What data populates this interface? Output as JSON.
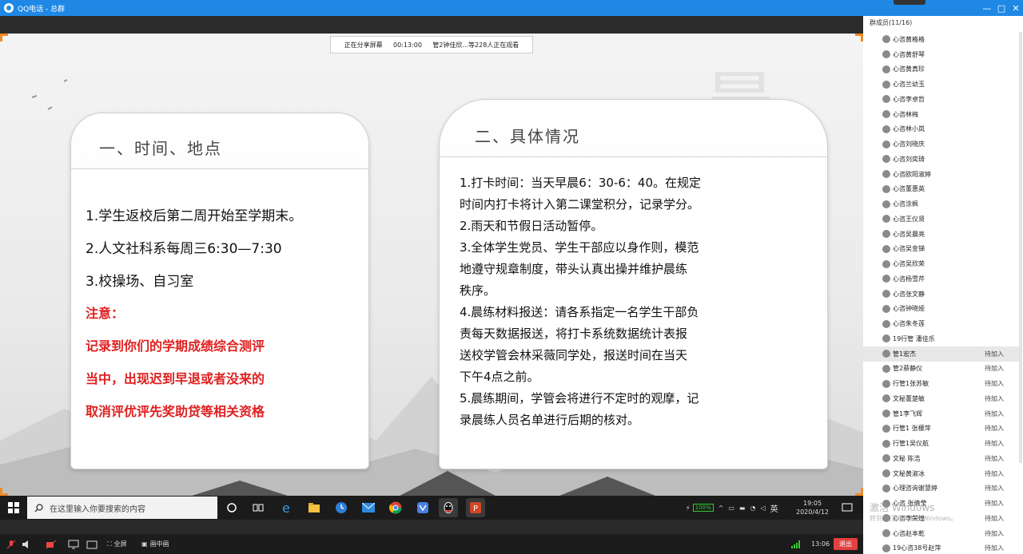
{
  "window": {
    "title": "QQ电话 - 总群",
    "controls": [
      "—",
      "□",
      "✕"
    ]
  },
  "share_bar": {
    "status": "正在分享屏幕",
    "duration": "00:13:00",
    "viewers": "管2钟佳欣...等228人正在观看"
  },
  "slide": {
    "left_card": {
      "title": "一、时间、地点",
      "lines": [
        "1.学生返校后第二周开始至学期末。",
        "2.人文社科系每周三6:30—7:30",
        "3.校操场、自习室"
      ],
      "note_label": "注意：",
      "note_lines": [
        "记录到你们的学期成绩综合测评",
        "当中，出现迟到早退或者没来的",
        "取消评优评先奖助贷等相关资格"
      ]
    },
    "right_card": {
      "title": "二、具体情况",
      "lines": [
        "1.打卡时间：当天早晨6：30-6：40。在规定",
        "时间内打卡将计入第二课堂积分，记录学分。",
        "2.雨天和节假日活动暂停。",
        "3.全体学生党员、学生干部应以身作则，模范",
        "地遵守规章制度，带头认真出操并维护晨练",
        "秩序。",
        "4.晨练材料报送：请各系指定一名学生干部负",
        "责每天数据报送，将打卡系统数据统计表报",
        "送校学管会林采薇同学处，报送时间在当天",
        "下午4点之前。",
        "5.晨练期间，学管会将进行不定时的观摩，记",
        "录晨练人员名单进行后期的核对。"
      ]
    }
  },
  "taskbar": {
    "search_placeholder": "在这里输入你要搜索的内容",
    "battery": "100%",
    "ime": "英",
    "time": "19:05",
    "date": "2020/4/12"
  },
  "meeting_bar": {
    "fullscreen": "全屏",
    "pip": "画中画",
    "clock": "13:06",
    "exit": "退出"
  },
  "members": {
    "header": "群成员(11/16)",
    "items": [
      {
        "name": "心咨黄格格",
        "status": ""
      },
      {
        "name": "心咨黄舒琴",
        "status": ""
      },
      {
        "name": "心咨黄真珍",
        "status": ""
      },
      {
        "name": "心咨兰幼玉",
        "status": ""
      },
      {
        "name": "心咨李卓哲",
        "status": ""
      },
      {
        "name": "心咨林梅",
        "status": ""
      },
      {
        "name": "心咨林小岚",
        "status": ""
      },
      {
        "name": "心咨刘晓庆",
        "status": ""
      },
      {
        "name": "心咨刘奕琦",
        "status": ""
      },
      {
        "name": "心咨欧阳淑婷",
        "status": ""
      },
      {
        "name": "心咨董惠英",
        "status": ""
      },
      {
        "name": "心咨涂枫",
        "status": ""
      },
      {
        "name": "心咨王仪贤",
        "status": ""
      },
      {
        "name": "心咨吴晨亮",
        "status": ""
      },
      {
        "name": "心咨吴金锑",
        "status": ""
      },
      {
        "name": "心咨吴欣荣",
        "status": ""
      },
      {
        "name": "心咨杨雪芹",
        "status": ""
      },
      {
        "name": "心咨张文静",
        "status": ""
      },
      {
        "name": "心咨钟晓娅",
        "status": ""
      },
      {
        "name": "心咨朱冬莲",
        "status": ""
      },
      {
        "name": "19行管 潘佳乐",
        "status": ""
      },
      {
        "name": "管1宏杰",
        "status": "待加入"
      },
      {
        "name": "管2蔡静仪",
        "status": "待加入"
      },
      {
        "name": "行管1张苏敏",
        "status": "待加入"
      },
      {
        "name": "文秘董楚敏",
        "status": "待加入"
      },
      {
        "name": "管1李飞辉",
        "status": "待加入"
      },
      {
        "name": "行管1 张檬萍",
        "status": "待加入"
      },
      {
        "name": "行管1吴仪航",
        "status": "待加入"
      },
      {
        "name": "文秘 陈浩",
        "status": "待加入"
      },
      {
        "name": "文秘黄淑冰",
        "status": "待加入"
      },
      {
        "name": "心理咨询谢慧婷",
        "status": "待加入"
      },
      {
        "name": "心咨 张倩莹",
        "status": "待加入"
      },
      {
        "name": "心咨李荣煌",
        "status": "待加入"
      },
      {
        "name": "心咨赵本乾",
        "status": "待加入"
      },
      {
        "name": "19心咨38号赵萍",
        "status": "待加入"
      }
    ]
  },
  "watermark": {
    "line1": "激活 Windows",
    "line2": "转到\"设置\"以激活 Windows。"
  },
  "colors": {
    "titlebar": "#1f88e5",
    "accent_orange": "#f08a24",
    "note_red": "#e02020",
    "exit_red": "#e43f3f"
  }
}
